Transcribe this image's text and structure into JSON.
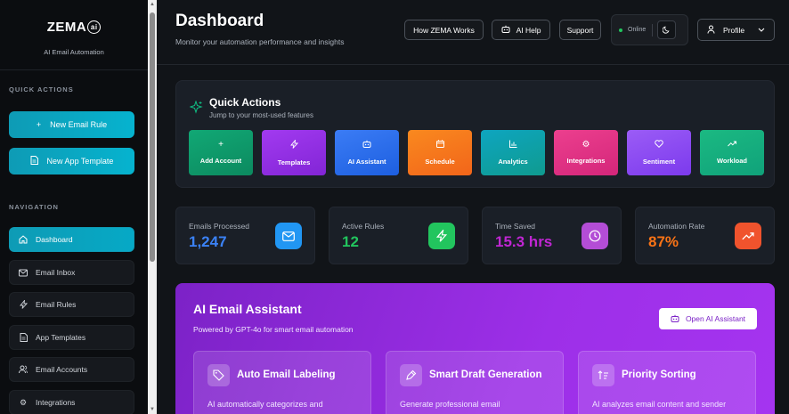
{
  "sidebar": {
    "logo_text": "ZEMA",
    "logo_badge": "ai",
    "subtitle": "AI Email Automation",
    "quick_actions_title": "QUICK ACTIONS",
    "quick_actions": [
      {
        "label": "New Email Rule",
        "icon": "plus-icon"
      },
      {
        "label": "New App Template",
        "icon": "document-icon"
      }
    ],
    "navigation_title": "NAVIGATION",
    "nav_items": [
      {
        "label": "Dashboard",
        "icon": "home-icon",
        "active": true
      },
      {
        "label": "Email Inbox",
        "icon": "mail-icon"
      },
      {
        "label": "Email Rules",
        "icon": "bolt-icon"
      },
      {
        "label": "App Templates",
        "icon": "document-icon"
      },
      {
        "label": "Email Accounts",
        "icon": "users-icon"
      },
      {
        "label": "Integrations",
        "icon": "gear-icon"
      }
    ]
  },
  "header": {
    "title": "Dashboard",
    "subtitle": "Monitor your automation performance and insights",
    "how_label": "How ZEMA Works",
    "ai_help_label": "AI Help",
    "support_label": "Support",
    "status_label": "Online",
    "profile_label": "Profile"
  },
  "quick_actions_panel": {
    "title": "Quick Actions",
    "subtitle": "Jump to your most-used features",
    "tiles": [
      {
        "label": "Add Account",
        "icon": "plus-icon",
        "color": "#0f9f6e"
      },
      {
        "label": "Templates",
        "icon": "bolt-icon",
        "color": "#9333ea"
      },
      {
        "label": "AI Assistant",
        "icon": "robot-icon",
        "color": "#2563eb"
      },
      {
        "label": "Schedule",
        "icon": "calendar-icon",
        "color": "#f97316"
      },
      {
        "label": "Analytics",
        "icon": "chart-icon",
        "color": "#0891b2"
      },
      {
        "label": "Integrations",
        "icon": "gear-icon",
        "color": "#db2777"
      },
      {
        "label": "Sentiment",
        "icon": "heart-icon",
        "color": "#8b5cf6"
      },
      {
        "label": "Workload",
        "icon": "trend-icon",
        "color": "#10b981"
      }
    ]
  },
  "stats": [
    {
      "label": "Emails Processed",
      "value": "1,247",
      "color": "#3b82f6",
      "icon": "mail-icon",
      "icon_color": "#2196f3"
    },
    {
      "label": "Active Rules",
      "value": "12",
      "color": "#22c55e",
      "icon": "bolt-icon",
      "icon_color": "#22c55e"
    },
    {
      "label": "Time Saved",
      "value": "15.3 hrs",
      "color": "#c026d3",
      "icon": "clock-icon",
      "icon_color": "#b44dd6"
    },
    {
      "label": "Automation Rate",
      "value": "87%",
      "color": "#f97316",
      "icon": "trend-icon",
      "icon_color": "#f0532d"
    }
  ],
  "ai_assistant": {
    "title": "AI Email Assistant",
    "subtitle": "Powered by GPT-4o for smart email automation",
    "button_label": "Open AI Assistant",
    "features": [
      {
        "title": "Auto Email Labeling",
        "icon": "tag-icon",
        "desc": "AI automatically categorizes and"
      },
      {
        "title": "Smart Draft Generation",
        "icon": "pen-icon",
        "desc": "Generate professional email"
      },
      {
        "title": "Priority Sorting",
        "icon": "sort-icon",
        "desc": "AI analyzes email content and sender"
      }
    ]
  }
}
